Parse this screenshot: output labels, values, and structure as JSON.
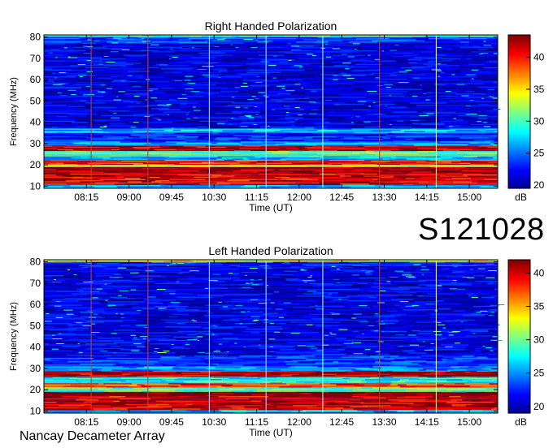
{
  "event_code": "S121028",
  "footer_label": "Nancay Decameter Array",
  "colormap": [
    "#00008f",
    "#0000ff",
    "#0080ff",
    "#00ffff",
    "#80ff80",
    "#ffff00",
    "#ff8000",
    "#ff0000",
    "#800000"
  ],
  "chart_data": [
    {
      "type": "heatmap",
      "title": "Right Handed Polarization",
      "xlabel": "Time (UT)",
      "ylabel": "Frequency (MHz)",
      "xticks": [
        "08:15",
        "09:00",
        "09:45",
        "10:30",
        "11:15",
        "12:00",
        "12:45",
        "13:30",
        "14:15",
        "15:00"
      ],
      "xlim": [
        "07:30",
        "15:30"
      ],
      "yticks": [
        10,
        20,
        30,
        40,
        50,
        60,
        70,
        80
      ],
      "ylim": [
        9,
        81
      ],
      "colorbar": {
        "label": "dB",
        "ticks": [
          20,
          25,
          30,
          35,
          40
        ],
        "range": [
          19.5,
          43.5
        ]
      },
      "marker_lines": [
        {
          "time": "08:20",
          "color": "#c04020"
        },
        {
          "time": "09:20",
          "color": "#c04020"
        },
        {
          "time": "10:25",
          "color": "#a0e0ff"
        },
        {
          "time": "11:25",
          "color": "#a0e0ff"
        },
        {
          "time": "12:25",
          "color": "#a0ffd0"
        },
        {
          "time": "13:25",
          "color": "#c04020"
        },
        {
          "time": "14:25",
          "color": "#ffff60"
        }
      ],
      "bands": [
        {
          "from": 9,
          "to": 10.5,
          "level": 27
        },
        {
          "from": 10.5,
          "to": 16,
          "level": 41
        },
        {
          "from": 16,
          "to": 19,
          "level": 43
        },
        {
          "from": 19,
          "to": 20,
          "level": 33
        },
        {
          "from": 20,
          "to": 22,
          "level": 40
        },
        {
          "from": 22,
          "to": 24,
          "level": 27
        },
        {
          "from": 24,
          "to": 26.5,
          "level": 31
        },
        {
          "from": 26.5,
          "to": 29,
          "level": 42
        },
        {
          "from": 29,
          "to": 31,
          "level": 26
        },
        {
          "from": 31,
          "to": 35,
          "level": 23
        },
        {
          "from": 35,
          "to": 37,
          "level": 27
        },
        {
          "from": 37,
          "to": 77,
          "level": 21.5
        },
        {
          "from": 77,
          "to": 80,
          "level": 24
        },
        {
          "from": 80,
          "to": 81,
          "level": 30
        }
      ]
    },
    {
      "type": "heatmap",
      "title": "Left Handed Polarization",
      "xlabel": "Time (UT)",
      "ylabel": "Frequency (MHz)",
      "xticks": [
        "08:15",
        "09:00",
        "09:45",
        "10:30",
        "11:15",
        "12:00",
        "12:45",
        "13:30",
        "14:15",
        "15:00"
      ],
      "xlim": [
        "07:30",
        "15:30"
      ],
      "yticks": [
        10,
        20,
        30,
        40,
        50,
        60,
        70,
        80
      ],
      "ylim": [
        9,
        81
      ],
      "colorbar": {
        "label": "dB",
        "ticks": [
          20,
          25,
          30,
          35,
          40
        ],
        "range": [
          19,
          42
        ]
      },
      "marker_lines": [
        {
          "time": "08:20",
          "color": "#c04020"
        },
        {
          "time": "09:20",
          "color": "#c04020"
        },
        {
          "time": "10:25",
          "color": "#a0e0ff"
        },
        {
          "time": "11:25",
          "color": "#a0e0ff"
        },
        {
          "time": "12:25",
          "color": "#a0ffd0"
        },
        {
          "time": "13:25",
          "color": "#c04020"
        },
        {
          "time": "14:25",
          "color": "#ffff60"
        }
      ],
      "bands": [
        {
          "from": 9,
          "to": 10.5,
          "level": 26
        },
        {
          "from": 10.5,
          "to": 17,
          "level": 40
        },
        {
          "from": 17,
          "to": 19,
          "level": 42
        },
        {
          "from": 19,
          "to": 21,
          "level": 30
        },
        {
          "from": 21,
          "to": 23,
          "level": 38
        },
        {
          "from": 23,
          "to": 26,
          "level": 28
        },
        {
          "from": 26,
          "to": 28.5,
          "level": 41
        },
        {
          "from": 28.5,
          "to": 31,
          "level": 25
        },
        {
          "from": 31,
          "to": 36,
          "level": 23
        },
        {
          "from": 36,
          "to": 78,
          "level": 21
        },
        {
          "from": 78,
          "to": 80,
          "level": 23
        },
        {
          "from": 80,
          "to": 81,
          "level": 33
        }
      ]
    }
  ]
}
